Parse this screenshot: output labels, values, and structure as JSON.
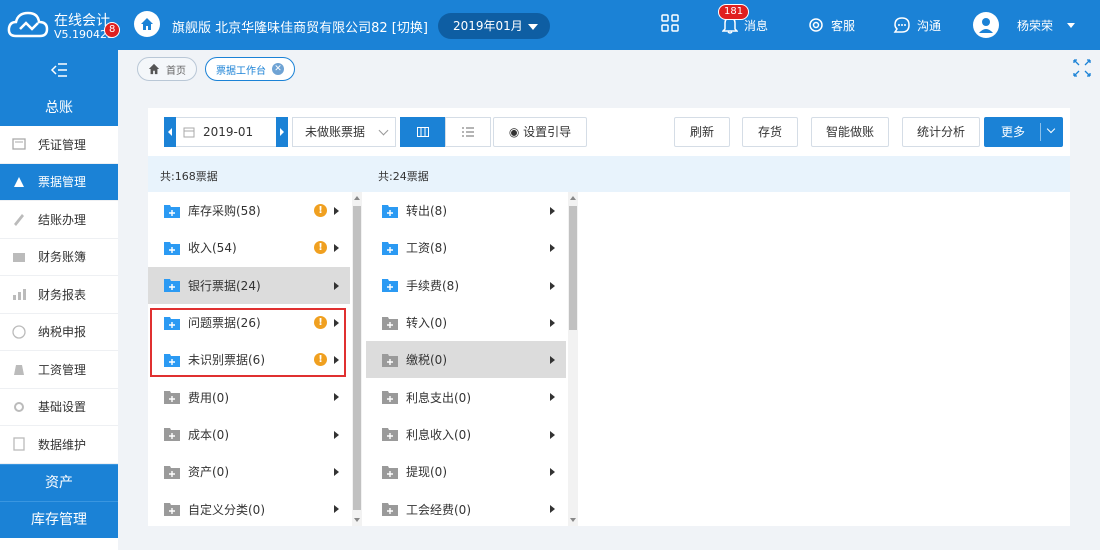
{
  "app": {
    "name": "在线会计",
    "version": "V5.190425",
    "version_badge": "8"
  },
  "header": {
    "company": "旗舰版 北京华隆味佳商贸有限公司82 [切换]",
    "period": "2019年01月",
    "messages_count": "181",
    "messages_label": "消息",
    "service_label": "客服",
    "chat_label": "沟通",
    "user_name": "杨荣荣"
  },
  "sidebar": {
    "ledger_title": "总账",
    "items": [
      {
        "label": "凭证管理",
        "icon": "voucher-icon"
      },
      {
        "label": "票据管理",
        "icon": "bill-icon"
      },
      {
        "label": "结账办理",
        "icon": "pen-icon"
      },
      {
        "label": "财务账簿",
        "icon": "book-icon"
      },
      {
        "label": "财务报表",
        "icon": "bar-chart-icon"
      },
      {
        "label": "纳税申报",
        "icon": "tax-icon"
      },
      {
        "label": "工资管理",
        "icon": "money-bag-icon"
      },
      {
        "label": "基础设置",
        "icon": "gear-icon"
      },
      {
        "label": "数据维护",
        "icon": "database-icon"
      }
    ],
    "active_index": 1,
    "assets_title": "资产",
    "inventory_title": "库存管理"
  },
  "tabs": [
    {
      "label": "首页"
    },
    {
      "label": "票据工作台"
    }
  ],
  "toolbar": {
    "date": "2019-01",
    "filter": "未做账票据",
    "guide": "设置引导",
    "refresh": "刷新",
    "inventory": "存货",
    "smart": "智能做账",
    "stats": "统计分析",
    "more": "更多"
  },
  "left_list": {
    "total": "共:168票据",
    "items": [
      {
        "label": "库存采购(58)",
        "warn": true,
        "color": "blue"
      },
      {
        "label": "收入(54)",
        "warn": true,
        "color": "blue"
      },
      {
        "label": "银行票据(24)",
        "warn": false,
        "color": "blue",
        "selected": true
      },
      {
        "label": "问题票据(26)",
        "warn": true,
        "color": "blue"
      },
      {
        "label": "未识别票据(6)",
        "warn": true,
        "color": "blue"
      },
      {
        "label": "费用(0)",
        "warn": false,
        "color": "gray"
      },
      {
        "label": "成本(0)",
        "warn": false,
        "color": "gray"
      },
      {
        "label": "资产(0)",
        "warn": false,
        "color": "gray"
      },
      {
        "label": "自定义分类(0)",
        "warn": false,
        "color": "gray"
      }
    ]
  },
  "right_list": {
    "total": "共:24票据",
    "items": [
      {
        "label": "转出(8)",
        "color": "blue"
      },
      {
        "label": "工资(8)",
        "color": "blue"
      },
      {
        "label": "手续费(8)",
        "color": "blue"
      },
      {
        "label": "转入(0)",
        "color": "gray"
      },
      {
        "label": "缴税(0)",
        "color": "gray",
        "selected": true
      },
      {
        "label": "利息支出(0)",
        "color": "gray"
      },
      {
        "label": "利息收入(0)",
        "color": "gray"
      },
      {
        "label": "提现(0)",
        "color": "gray"
      },
      {
        "label": "工会经费(0)",
        "color": "gray"
      }
    ]
  },
  "colors": {
    "accent": "#1b82d6",
    "warn": "#f0a020",
    "highlight_border": "#e03030"
  }
}
